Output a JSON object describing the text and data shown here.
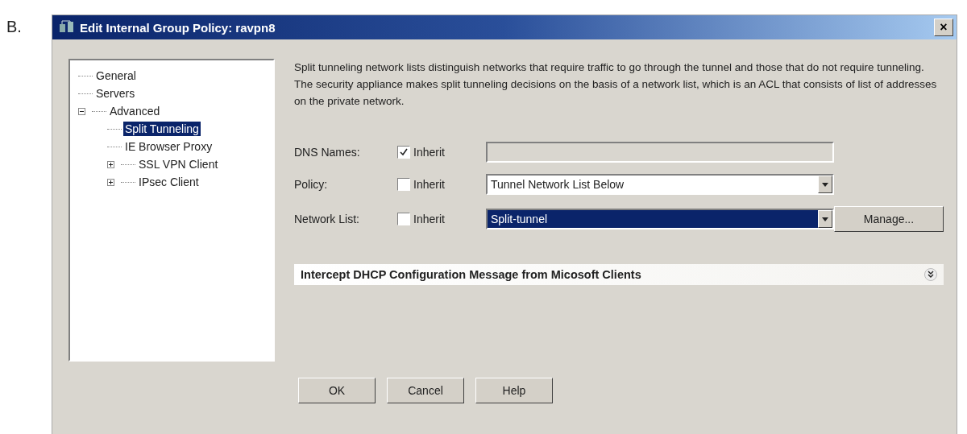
{
  "question_label": "B.",
  "window": {
    "title": "Edit Internal Group Policy: ravpn8",
    "close": "×"
  },
  "tree": [
    {
      "label": "General",
      "selected": false
    },
    {
      "label": "Servers",
      "selected": false
    },
    {
      "label": "Advanced",
      "selected": false,
      "expanded": true,
      "children": [
        {
          "label": "Split Tunneling",
          "selected": true
        },
        {
          "label": "IE Browser Proxy",
          "selected": false
        },
        {
          "label": "SSL VPN Client",
          "selected": false,
          "expanded": false
        },
        {
          "label": "IPsec Client",
          "selected": false,
          "expanded": false
        }
      ]
    }
  ],
  "description": "Split tunneling network lists distinguish networks that require traffic to go through the tunnel and those that do not require tunneling. The security appliance makes split tunneling decisions on the basis of a network list, which is an ACL that consists of list of addresses on the private network.",
  "fields": [
    {
      "kind": "text",
      "label": "DNS Names:",
      "inherit_label": "Inherit",
      "inherit": true
    },
    {
      "kind": "select",
      "label": "Policy:",
      "inherit_label": "Inherit",
      "inherit": false,
      "value": "Tunnel Network List Below",
      "highlighted": false
    },
    {
      "kind": "select",
      "label": "Network List:",
      "inherit_label": "Inherit",
      "inherit": false,
      "value": "Split-tunnel",
      "highlighted": true,
      "button": "Manage..."
    }
  ],
  "section": {
    "title": "Intercept DHCP Configuration Message from Micosoft Clients",
    "expanded": false
  },
  "buttons": [
    "OK",
    "Cancel",
    "Help"
  ]
}
